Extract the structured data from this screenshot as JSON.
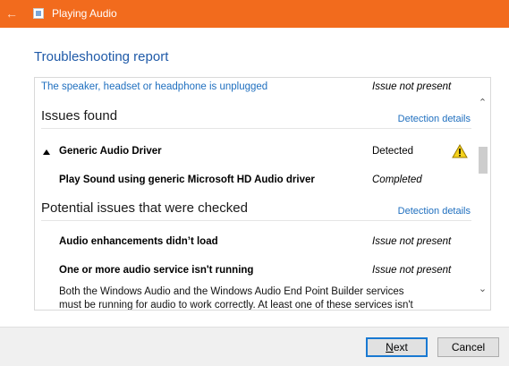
{
  "window": {
    "title": "Playing Audio",
    "back_icon": "back-arrow-icon",
    "accent_color": "#f26b1d"
  },
  "page": {
    "heading": "Troubleshooting report"
  },
  "report": {
    "top_item": {
      "label": "The speaker, headset or headphone is unplugged",
      "status": "Issue not present"
    },
    "issues_found": {
      "title": "Issues found",
      "details_link": "Detection details",
      "items": [
        {
          "label": "Generic Audio Driver",
          "status": "Detected",
          "icon": "warning-icon"
        },
        {
          "label": "Play Sound using generic Microsoft HD Audio driver",
          "status": "Completed"
        }
      ]
    },
    "potential": {
      "title": "Potential issues that were checked",
      "details_link": "Detection details",
      "items": [
        {
          "label": "Audio enhancements didn’t load",
          "status": "Issue not present"
        },
        {
          "label": "One or more audio service isn't running",
          "status": "Issue not present"
        }
      ],
      "description_line1": "Both the Windows Audio and the Windows Audio End Point Builder services",
      "description_line2": "must be running for audio to work correctly. At least one of these services isn't"
    }
  },
  "footer": {
    "next_label_first": "N",
    "next_label_rest": "ext",
    "cancel_label": "Cancel"
  }
}
